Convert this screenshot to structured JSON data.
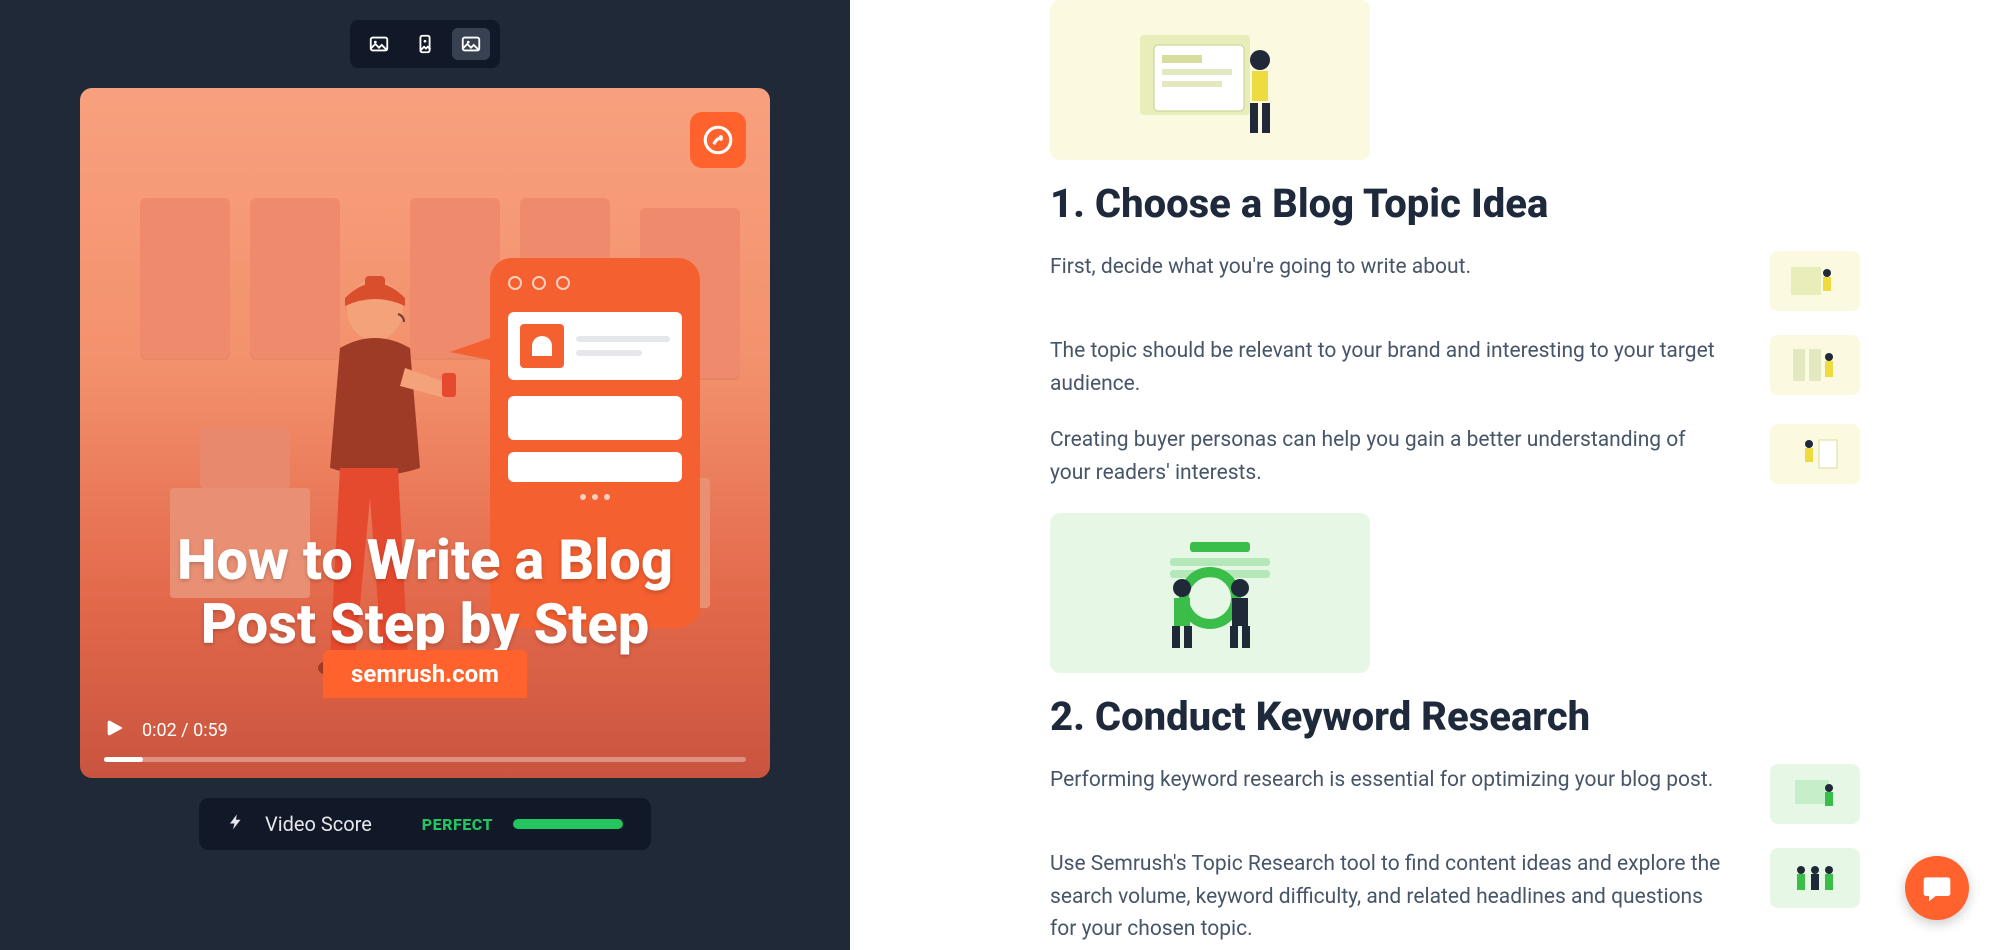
{
  "toolbar": {
    "buttons": [
      "image-icon",
      "portrait-icon",
      "landscape-icon"
    ]
  },
  "video": {
    "title": "How to Write a Blog Post Step by Step",
    "watermark": "semrush.com",
    "current_time": "0:02",
    "duration": "0:59",
    "score_label": "Video Score",
    "score_value": "PERFECT"
  },
  "article": {
    "sections": [
      {
        "heading": "1. Choose a Blog Topic Idea",
        "illus_theme": "yellow",
        "paragraphs": [
          "First, decide what you're going to write about.",
          "The topic should be relevant to your brand and interesting to your target audience.",
          "Creating buyer personas can help you gain a better understanding of your readers' interests."
        ]
      },
      {
        "heading": "2. Conduct Keyword Research",
        "illus_theme": "green",
        "paragraphs": [
          "Performing keyword research is essential for optimizing your blog post.",
          "Use Semrush's Topic Research tool to find content ideas and explore the search volume, keyword difficulty, and related headlines and questions for your chosen topic."
        ]
      }
    ]
  }
}
